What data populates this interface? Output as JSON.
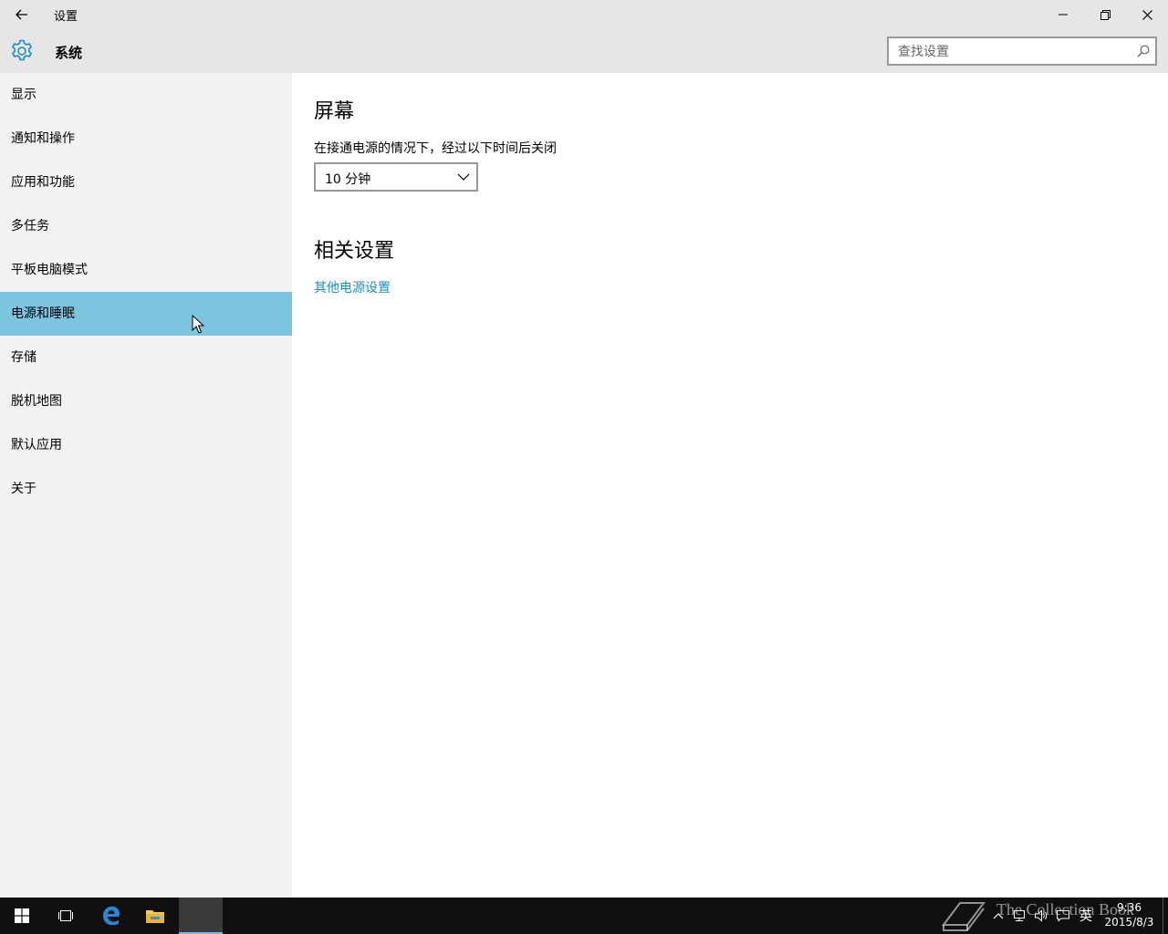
{
  "window": {
    "title": "设置"
  },
  "header": {
    "title": "系统",
    "search_placeholder": "查找设置"
  },
  "sidebar": {
    "items": [
      {
        "label": "显示"
      },
      {
        "label": "通知和操作"
      },
      {
        "label": "应用和功能"
      },
      {
        "label": "多任务"
      },
      {
        "label": "平板电脑模式"
      },
      {
        "label": "电源和睡眠",
        "selected": true
      },
      {
        "label": "存储"
      },
      {
        "label": "脱机地图"
      },
      {
        "label": "默认应用"
      },
      {
        "label": "关于"
      }
    ]
  },
  "main": {
    "screen_title": "屏幕",
    "screen_label": "在接通电源的情况下，经过以下时间后关闭",
    "screen_timeout_value": "10 分钟",
    "related_title": "相关设置",
    "related_link": "其他电源设置"
  },
  "taskbar": {
    "ime_label": "英",
    "time": "9:36",
    "date": "2015/8/3"
  },
  "watermark": {
    "text": "The Collection Book"
  },
  "colors": {
    "accent": "#1a8dc4",
    "selected_bg": "#7cc5df",
    "chrome_bg": "#e6e6e6",
    "sidebar_bg": "#f2f2f2",
    "taskbar_bg": "#101010"
  }
}
